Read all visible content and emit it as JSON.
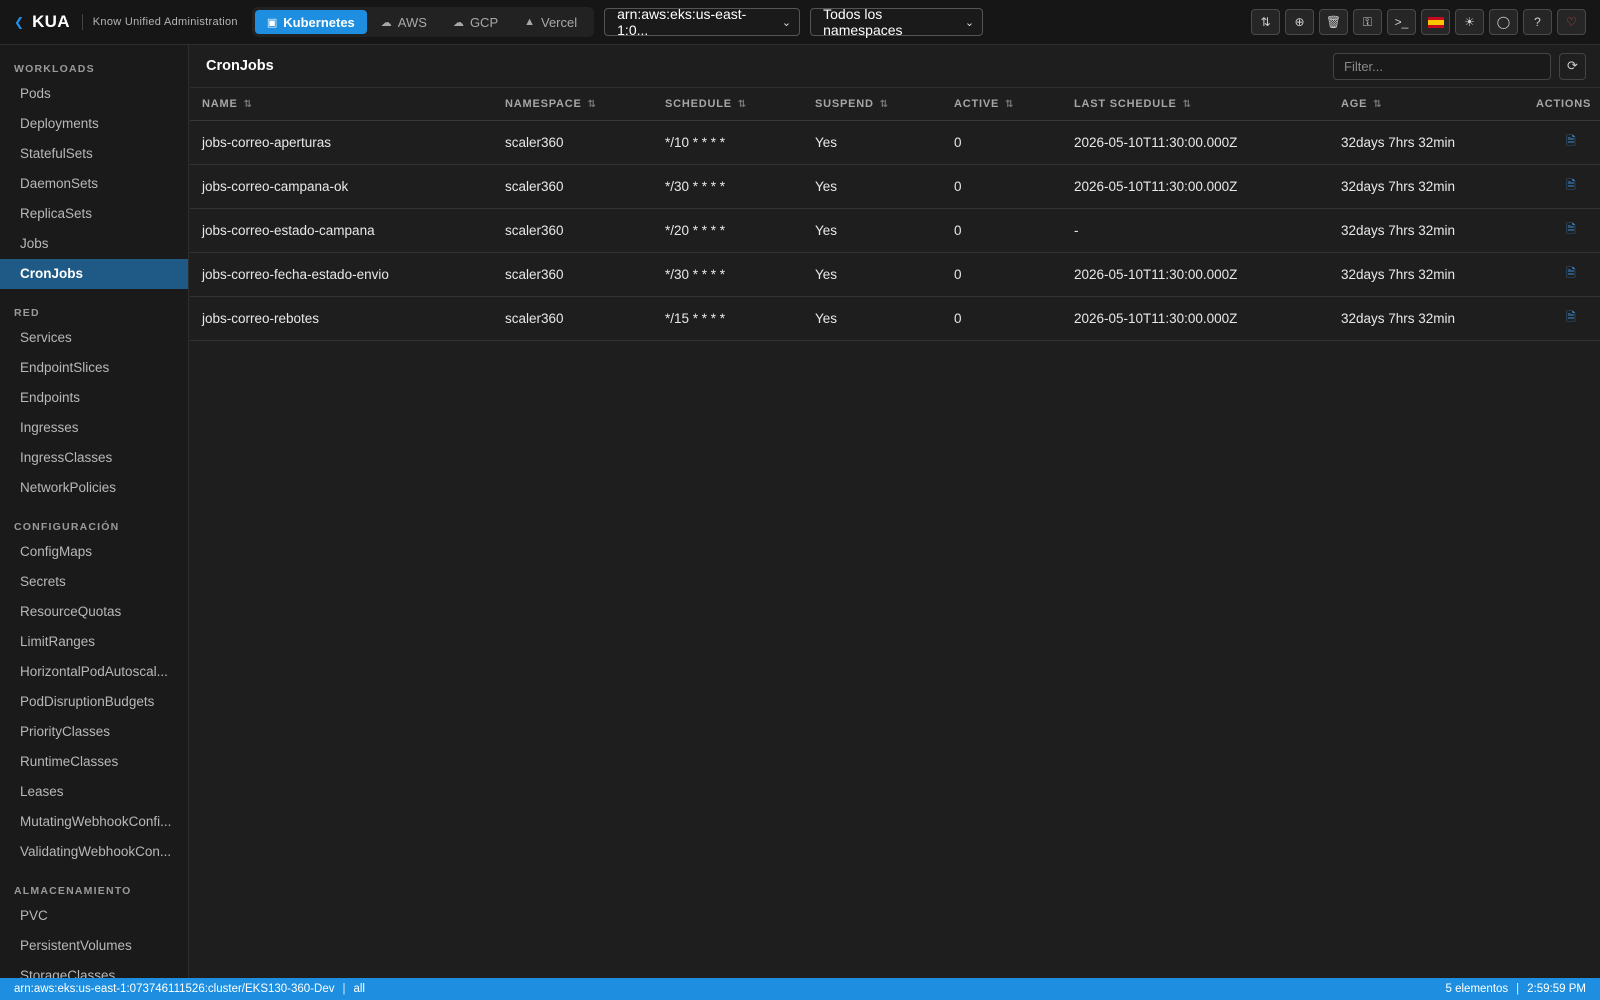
{
  "app": {
    "name": "KUA",
    "subtitle": "Know Unified Administration"
  },
  "providers": [
    {
      "label": "Kubernetes",
      "icon": "cube-icon",
      "active": true
    },
    {
      "label": "AWS",
      "icon": "cloud-icon",
      "active": false
    },
    {
      "label": "GCP",
      "icon": "cloud-icon",
      "active": false
    },
    {
      "label": "Vercel",
      "icon": "triangle-icon",
      "active": false
    }
  ],
  "cluster_select": {
    "value": "arn:aws:eks:us-east-1:0..."
  },
  "namespace_select": {
    "value": "Todos los namespaces"
  },
  "toolbar_icons": [
    "port-forward-icon",
    "add-icon",
    "delete-icon",
    "key-icon",
    "terminal-icon",
    "spain-flag-icon",
    "theme-sun-icon",
    "shield-icon",
    "help-icon",
    "heart-icon"
  ],
  "sidebar": {
    "sections": [
      {
        "title": "WORKLOADS",
        "items": [
          "Pods",
          "Deployments",
          "StatefulSets",
          "DaemonSets",
          "ReplicaSets",
          "Jobs",
          "CronJobs"
        ]
      },
      {
        "title": "RED",
        "items": [
          "Services",
          "EndpointSlices",
          "Endpoints",
          "Ingresses",
          "IngressClasses",
          "NetworkPolicies"
        ]
      },
      {
        "title": "CONFIGURACIÓN",
        "items": [
          "ConfigMaps",
          "Secrets",
          "ResourceQuotas",
          "LimitRanges",
          "HorizontalPodAutoscal...",
          "PodDisruptionBudgets",
          "PriorityClasses",
          "RuntimeClasses",
          "Leases",
          "MutatingWebhookConfi...",
          "ValidatingWebhookCon..."
        ]
      },
      {
        "title": "ALMACENAMIENTO",
        "items": [
          "PVC",
          "PersistentVolumes",
          "StorageClasses"
        ]
      }
    ],
    "active_item": "CronJobs"
  },
  "main": {
    "title": "CronJobs",
    "filter_placeholder": "Filter...",
    "columns": [
      "NAME",
      "NAMESPACE",
      "SCHEDULE",
      "SUSPEND",
      "ACTIVE",
      "LAST SCHEDULE",
      "AGE",
      "ACTIONS"
    ],
    "rows": [
      {
        "name": "jobs-correo-aperturas",
        "namespace": "scaler360",
        "schedule": "*/10 * * * *",
        "suspend": "Yes",
        "active": "0",
        "last_schedule": "2026-05-10T11:30:00.000Z",
        "age": "32days 7hrs 32min"
      },
      {
        "name": "jobs-correo-campana-ok",
        "namespace": "scaler360",
        "schedule": "*/30 * * * *",
        "suspend": "Yes",
        "active": "0",
        "last_schedule": "2026-05-10T11:30:00.000Z",
        "age": "32days 7hrs 32min"
      },
      {
        "name": "jobs-correo-estado-campana",
        "namespace": "scaler360",
        "schedule": "*/20 * * * *",
        "suspend": "Yes",
        "active": "0",
        "last_schedule": "-",
        "age": "32days 7hrs 32min"
      },
      {
        "name": "jobs-correo-fecha-estado-envio",
        "namespace": "scaler360",
        "schedule": "*/30 * * * *",
        "suspend": "Yes",
        "active": "0",
        "last_schedule": "2026-05-10T11:30:00.000Z",
        "age": "32days 7hrs 32min"
      },
      {
        "name": "jobs-correo-rebotes",
        "namespace": "scaler360",
        "schedule": "*/15 * * * *",
        "suspend": "Yes",
        "active": "0",
        "last_schedule": "2026-05-10T11:30:00.000Z",
        "age": "32days 7hrs 32min"
      }
    ]
  },
  "statusbar": {
    "cluster": "arn:aws:eks:us-east-1:073746111526:cluster/EKS130-360-Dev",
    "namespace": "all",
    "count": "5 elementos",
    "time": "2:59:59 PM"
  },
  "colors": {
    "accent": "#1e8fe0",
    "sidebar_active": "#1f5a87",
    "background": "#1e1e1e",
    "heart": "#e24a4a"
  }
}
